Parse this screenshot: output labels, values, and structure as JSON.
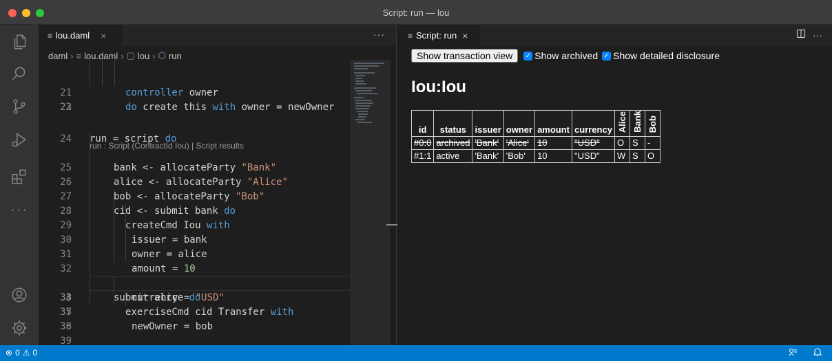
{
  "window": {
    "title": "Script: run — lou"
  },
  "colors": {
    "accent": "#007acc",
    "close": "#ff5f57",
    "minimize": "#febc2e",
    "zoom": "#28c840",
    "checkbox": "#0a84ff"
  },
  "activity_icons": [
    "files-icon",
    "search-icon",
    "source-control-icon",
    "run-debug-icon",
    "extensions-icon",
    "more-icon",
    "account-icon",
    "settings-gear-icon"
  ],
  "editor": {
    "tab_label": "lou.daml",
    "breadcrumb": [
      "daml",
      "lou.daml",
      "lou",
      "run"
    ],
    "codelens": "run : Script (ContractId Iou) | Script results",
    "current_line": "33"
  },
  "preview": {
    "tab_label": "Script: run",
    "button_label": "Show transaction view",
    "archived_label": "Show archived",
    "disclosure_label": "Show detailed disclosure",
    "heading": "Iou:Iou",
    "columns": [
      "id",
      "status",
      "issuer",
      "owner",
      "amount",
      "currency",
      "Alice",
      "Bank",
      "Bob"
    ],
    "rows": [
      [
        "#0:0",
        "archived",
        "'Bank'",
        "'Alice'",
        "10",
        "\"USD\"",
        "O",
        "S",
        "-"
      ],
      [
        "#1:1",
        "active",
        "'Bank'",
        "'Bob'",
        "10",
        "\"USD\"",
        "W",
        "S",
        "O"
      ]
    ]
  },
  "status": {
    "errors": "0",
    "warnings": "0"
  }
}
